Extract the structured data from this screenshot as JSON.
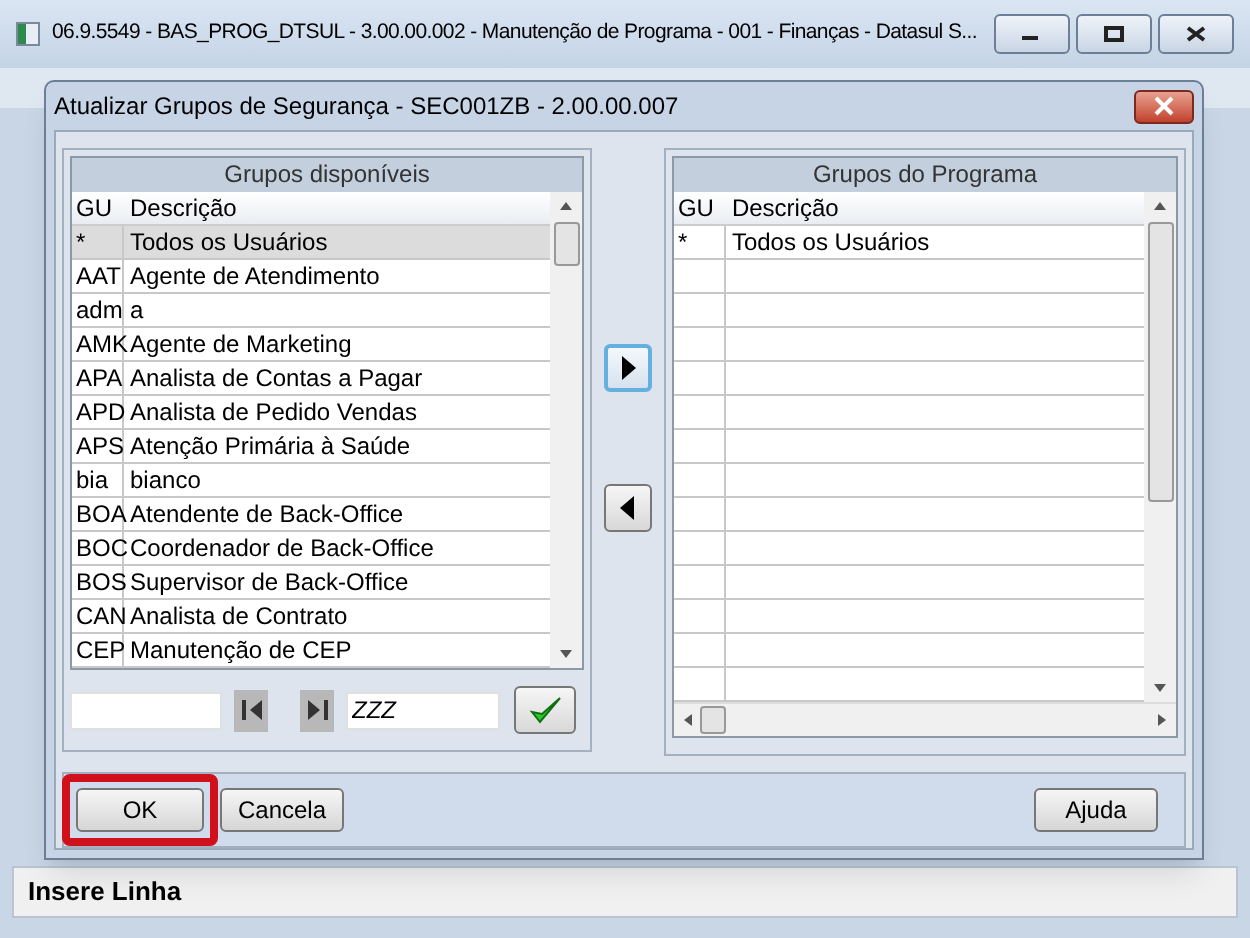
{
  "window": {
    "title": "06.9.5549 - BAS_PROG_DTSUL - 3.00.00.002 - Manutenção de Programa - 001 - Finanças - Datasul S..."
  },
  "dialog": {
    "title": "Atualizar Grupos de Segurança - SEC001ZB - 2.00.00.007",
    "available": {
      "title": "Grupos disponíveis",
      "columns": [
        "GU",
        "Descrição"
      ],
      "rows": [
        {
          "gu": "*",
          "description": "Todos os Usuários",
          "selected": true
        },
        {
          "gu": "AAT",
          "description": "Agente de Atendimento",
          "selected": false
        },
        {
          "gu": "adm",
          "description": "a",
          "selected": false
        },
        {
          "gu": "AMK",
          "description": "Agente de Marketing",
          "selected": false
        },
        {
          "gu": "APA",
          "description": "Analista de Contas a Pagar",
          "selected": false
        },
        {
          "gu": "APD",
          "description": "Analista de Pedido Vendas",
          "selected": false
        },
        {
          "gu": "APS",
          "description": "Atenção Primária à Saúde",
          "selected": false
        },
        {
          "gu": "bia",
          "description": "bianco",
          "selected": false
        },
        {
          "gu": "BOA",
          "description": "Atendente de Back-Office",
          "selected": false
        },
        {
          "gu": "BOC",
          "description": "Coordenador de Back-Office",
          "selected": false
        },
        {
          "gu": "BOS",
          "description": "Supervisor de Back-Office",
          "selected": false
        },
        {
          "gu": "CAN",
          "description": "Analista de Contrato",
          "selected": false
        },
        {
          "gu": "CEP",
          "description": "Manutenção de CEP",
          "selected": false
        }
      ],
      "range_to": "ZZZ"
    },
    "program": {
      "title": "Grupos do Programa",
      "columns": [
        "GU",
        "Descrição"
      ],
      "rows": [
        {
          "gu": "*",
          "description": "Todos os Usuários",
          "selected": false
        }
      ]
    },
    "buttons": [
      {
        "label": "OK",
        "highlighted": true
      },
      {
        "label": "Cancela",
        "highlighted": false
      },
      {
        "label": "Ajuda",
        "highlighted": false
      }
    ]
  },
  "status_bar": "Insere Linha"
}
